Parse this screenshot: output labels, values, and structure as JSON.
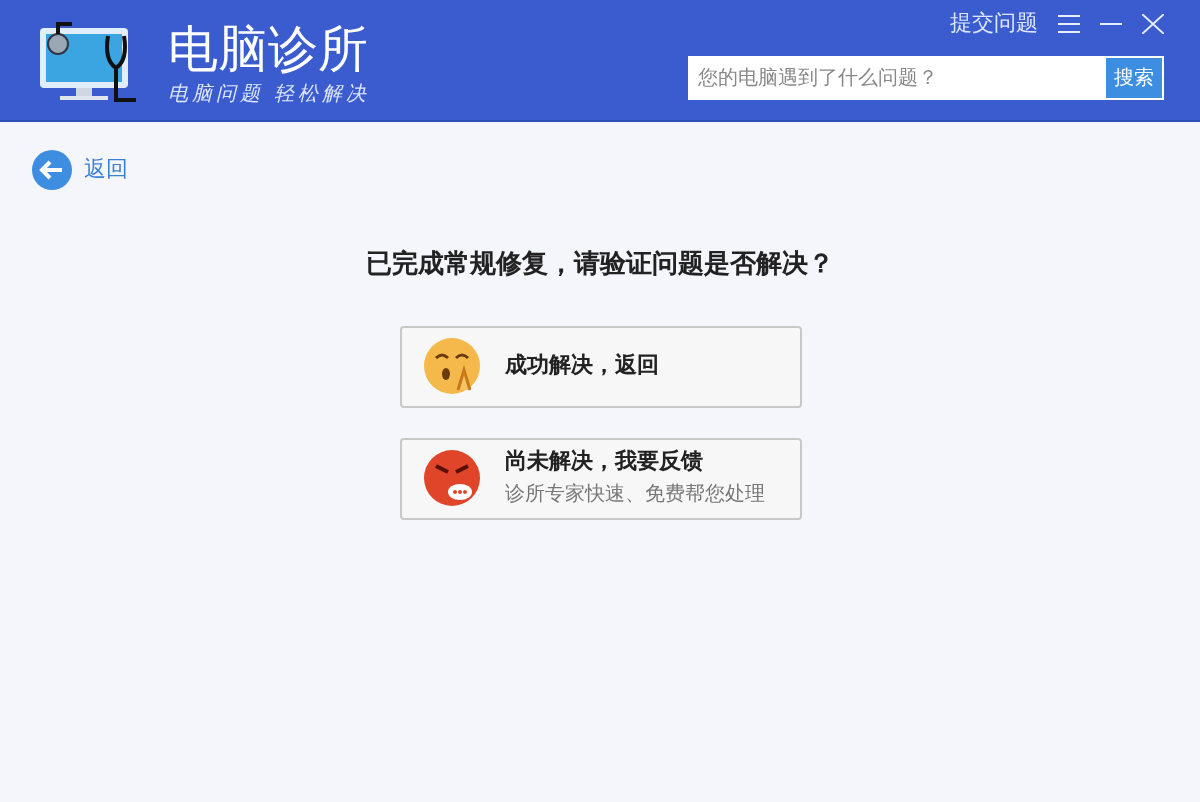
{
  "header": {
    "title": "电脑诊所",
    "slogan": "电脑问题 轻松解决",
    "submit_link": "提交问题",
    "search": {
      "placeholder": "您的电脑遇到了什么问题？",
      "button": "搜索"
    }
  },
  "back": "返回",
  "question": "已完成常规修复，请验证问题是否解决？",
  "options": [
    {
      "kind": "happy",
      "label": "成功解决，返回"
    },
    {
      "kind": "angry",
      "label": "尚未解决，我要反馈",
      "note": "诊所专家快速、免费帮您处理"
    }
  ]
}
